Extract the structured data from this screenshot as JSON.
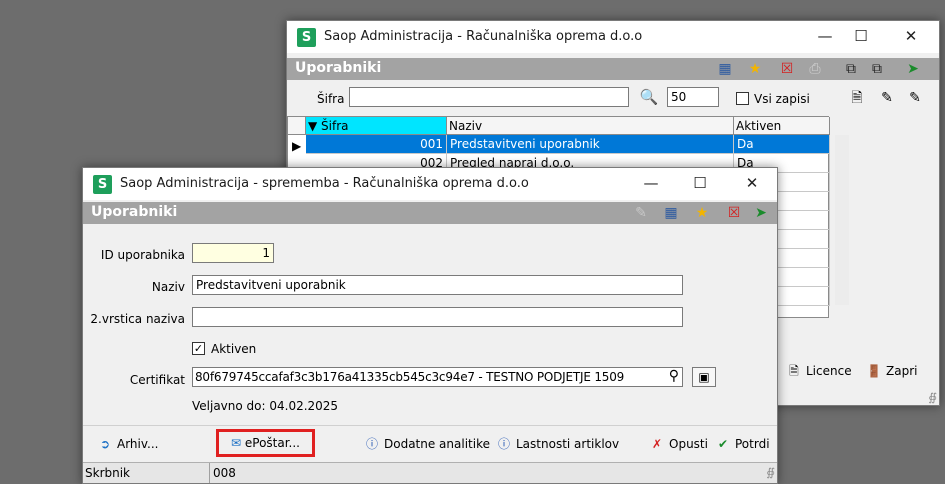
{
  "back_window": {
    "title": "Saop Administracija - Računalniška oprema d.o.o",
    "module": "Uporabniki",
    "filter": {
      "label": "Šifra",
      "value": "",
      "page_size": "50",
      "all_records_label": "Vsi zapisi"
    },
    "columns": [
      "Šifra",
      "Naziv",
      "Aktiven"
    ],
    "rows": [
      {
        "code": "001",
        "name": "Predstavitveni uporabnik",
        "active": "Da"
      },
      {
        "code": "002",
        "name": "Pregled napraj d.o.o.",
        "active": "Da"
      }
    ],
    "buttons": {
      "licence": "Licence",
      "close": "Zapri"
    }
  },
  "front_window": {
    "title": "Saop Administracija - sprememba - Računalniška oprema d.o.o",
    "module": "Uporabniki",
    "fields": {
      "id_label": "ID uporabnika",
      "id_value": "1",
      "name_label": "Naziv",
      "name_value": "Predstavitveni uporabnik",
      "name2_label": "2.vrstica naziva",
      "name2_value": "",
      "active_label": "Aktiven",
      "cert_label": "Certifikat",
      "cert_value": "80f679745ccafaf3c3b176a41335cb545c3c94e7 - TESTNO PODJETJE 1509",
      "valid_text": "Veljavno do: 04.02.2025"
    },
    "buttons": {
      "archive": "Arhiv...",
      "eposta": "ePoštar...",
      "analytics": "Dodatne analitike",
      "props": "Lastnosti artiklov",
      "cancel": "Opusti",
      "confirm": "Potrdi"
    },
    "status": {
      "label": "Skrbnik",
      "value": "008"
    },
    "highlight_color": "#e02020"
  }
}
